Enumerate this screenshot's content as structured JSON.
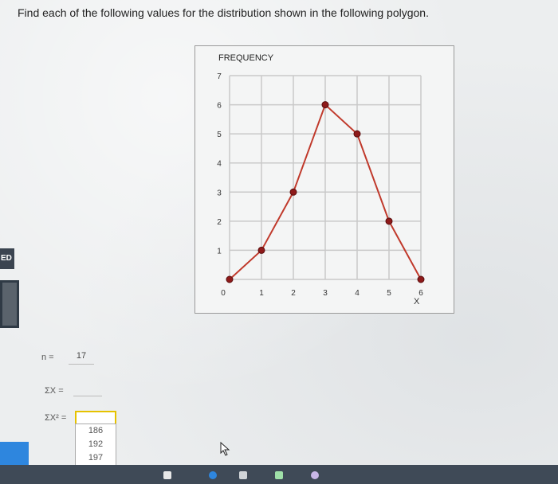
{
  "question": "Find each of the following values for the distribution shown in the following polygon.",
  "side_tab_label": "ED",
  "chart_data": {
    "type": "line",
    "ylabel": "FREQUENCY",
    "xlabel": "X",
    "x": [
      0,
      1,
      2,
      3,
      4,
      5,
      6
    ],
    "values": [
      0,
      1,
      3,
      6,
      5,
      2,
      0
    ],
    "xlim": [
      0,
      6
    ],
    "ylim": [
      0,
      7
    ],
    "x_ticks": [
      "0",
      "1",
      "2",
      "3",
      "4",
      "5",
      "6"
    ],
    "y_ticks": [
      "1",
      "2",
      "3",
      "4",
      "5",
      "6",
      "7"
    ],
    "grid": true,
    "line_color": "#c0392b",
    "marker_color": "#8e1a1a"
  },
  "answers": {
    "n_label": "n =",
    "n_value": "17",
    "sum_x_label": "ΣX =",
    "sum_x_value": "",
    "sum_x2_label": "ΣX² =",
    "sum_x2_value": ""
  },
  "dropdown_options": [
    "186",
    "192",
    "197"
  ]
}
